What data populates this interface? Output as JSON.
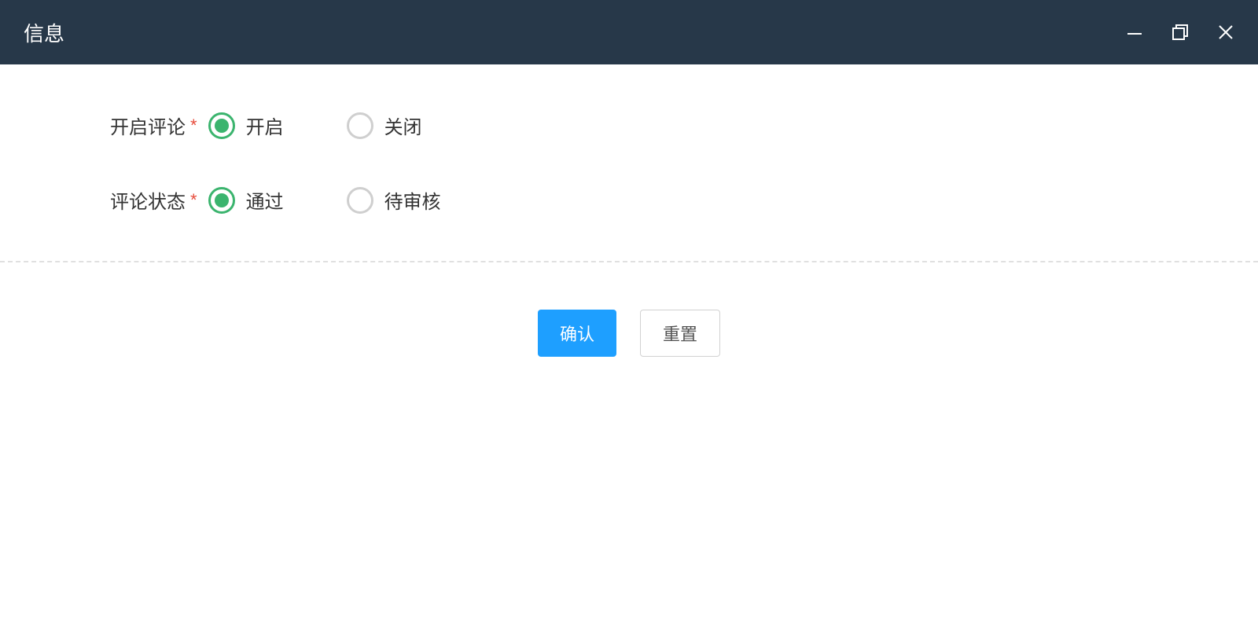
{
  "window": {
    "title": "信息"
  },
  "form": {
    "enable_comments": {
      "label": "开启评论",
      "required_mark": "*",
      "options": [
        {
          "label": "开启",
          "selected": true
        },
        {
          "label": "关闭",
          "selected": false
        }
      ]
    },
    "comment_status": {
      "label": "评论状态",
      "required_mark": "*",
      "options": [
        {
          "label": "通过",
          "selected": true
        },
        {
          "label": "待审核",
          "selected": false
        }
      ]
    }
  },
  "buttons": {
    "confirm": "确认",
    "reset": "重置"
  }
}
